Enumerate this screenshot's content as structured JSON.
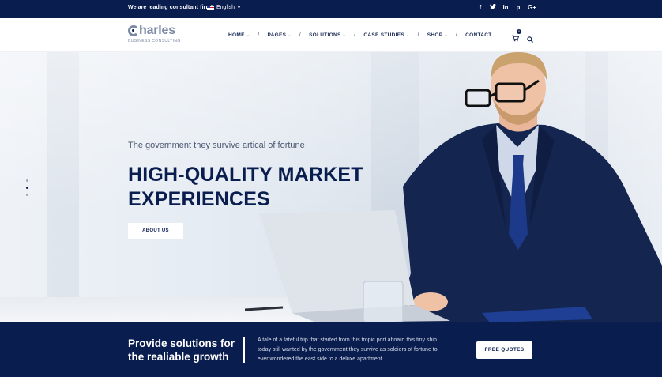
{
  "topbar": {
    "tagline": "We are leading consultant firm!",
    "language": "English",
    "social_icons": [
      "f",
      "t",
      "in",
      "p",
      "G+"
    ]
  },
  "header": {
    "logo_text": "harles",
    "logo_sub": "BUSINESS CONSULTING",
    "nav": [
      {
        "label": "HOME",
        "chevron": "⌄"
      },
      {
        "label": "PAGES",
        "chevron": "⌄"
      },
      {
        "label": "SOLUTIONS",
        "chevron": "⌄"
      },
      {
        "label": "CASE STUDIES",
        "chevron": "⌄"
      },
      {
        "label": "SHOP",
        "chevron": "⌄"
      },
      {
        "label": "CONTACT",
        "chevron": ""
      }
    ],
    "separator": "/",
    "cart_count": "0"
  },
  "hero": {
    "lead": "The government they survive artical of fortune",
    "title_line1": "HIGH-QUALITY MARKET",
    "title_line2": "EXPERIENCES",
    "button": "ABOUT US",
    "slide_count": 3,
    "active_slide": 2
  },
  "band": {
    "headline_line1": "Provide solutions for",
    "headline_line2": "the realiable growth",
    "desc_line1": "A tale of a fateful trip that started from this tropic port aboard this tiny ship",
    "desc_line2": "today still wanted by the government they survive as soldiers of fortune to",
    "desc_line3": "ever wondered the east side to a deluxe apartment.",
    "button": "FREE QUOTES"
  },
  "colors": {
    "navy": "#0a1d4f",
    "logo_grey": "#7b8aa6",
    "white": "#ffffff"
  }
}
